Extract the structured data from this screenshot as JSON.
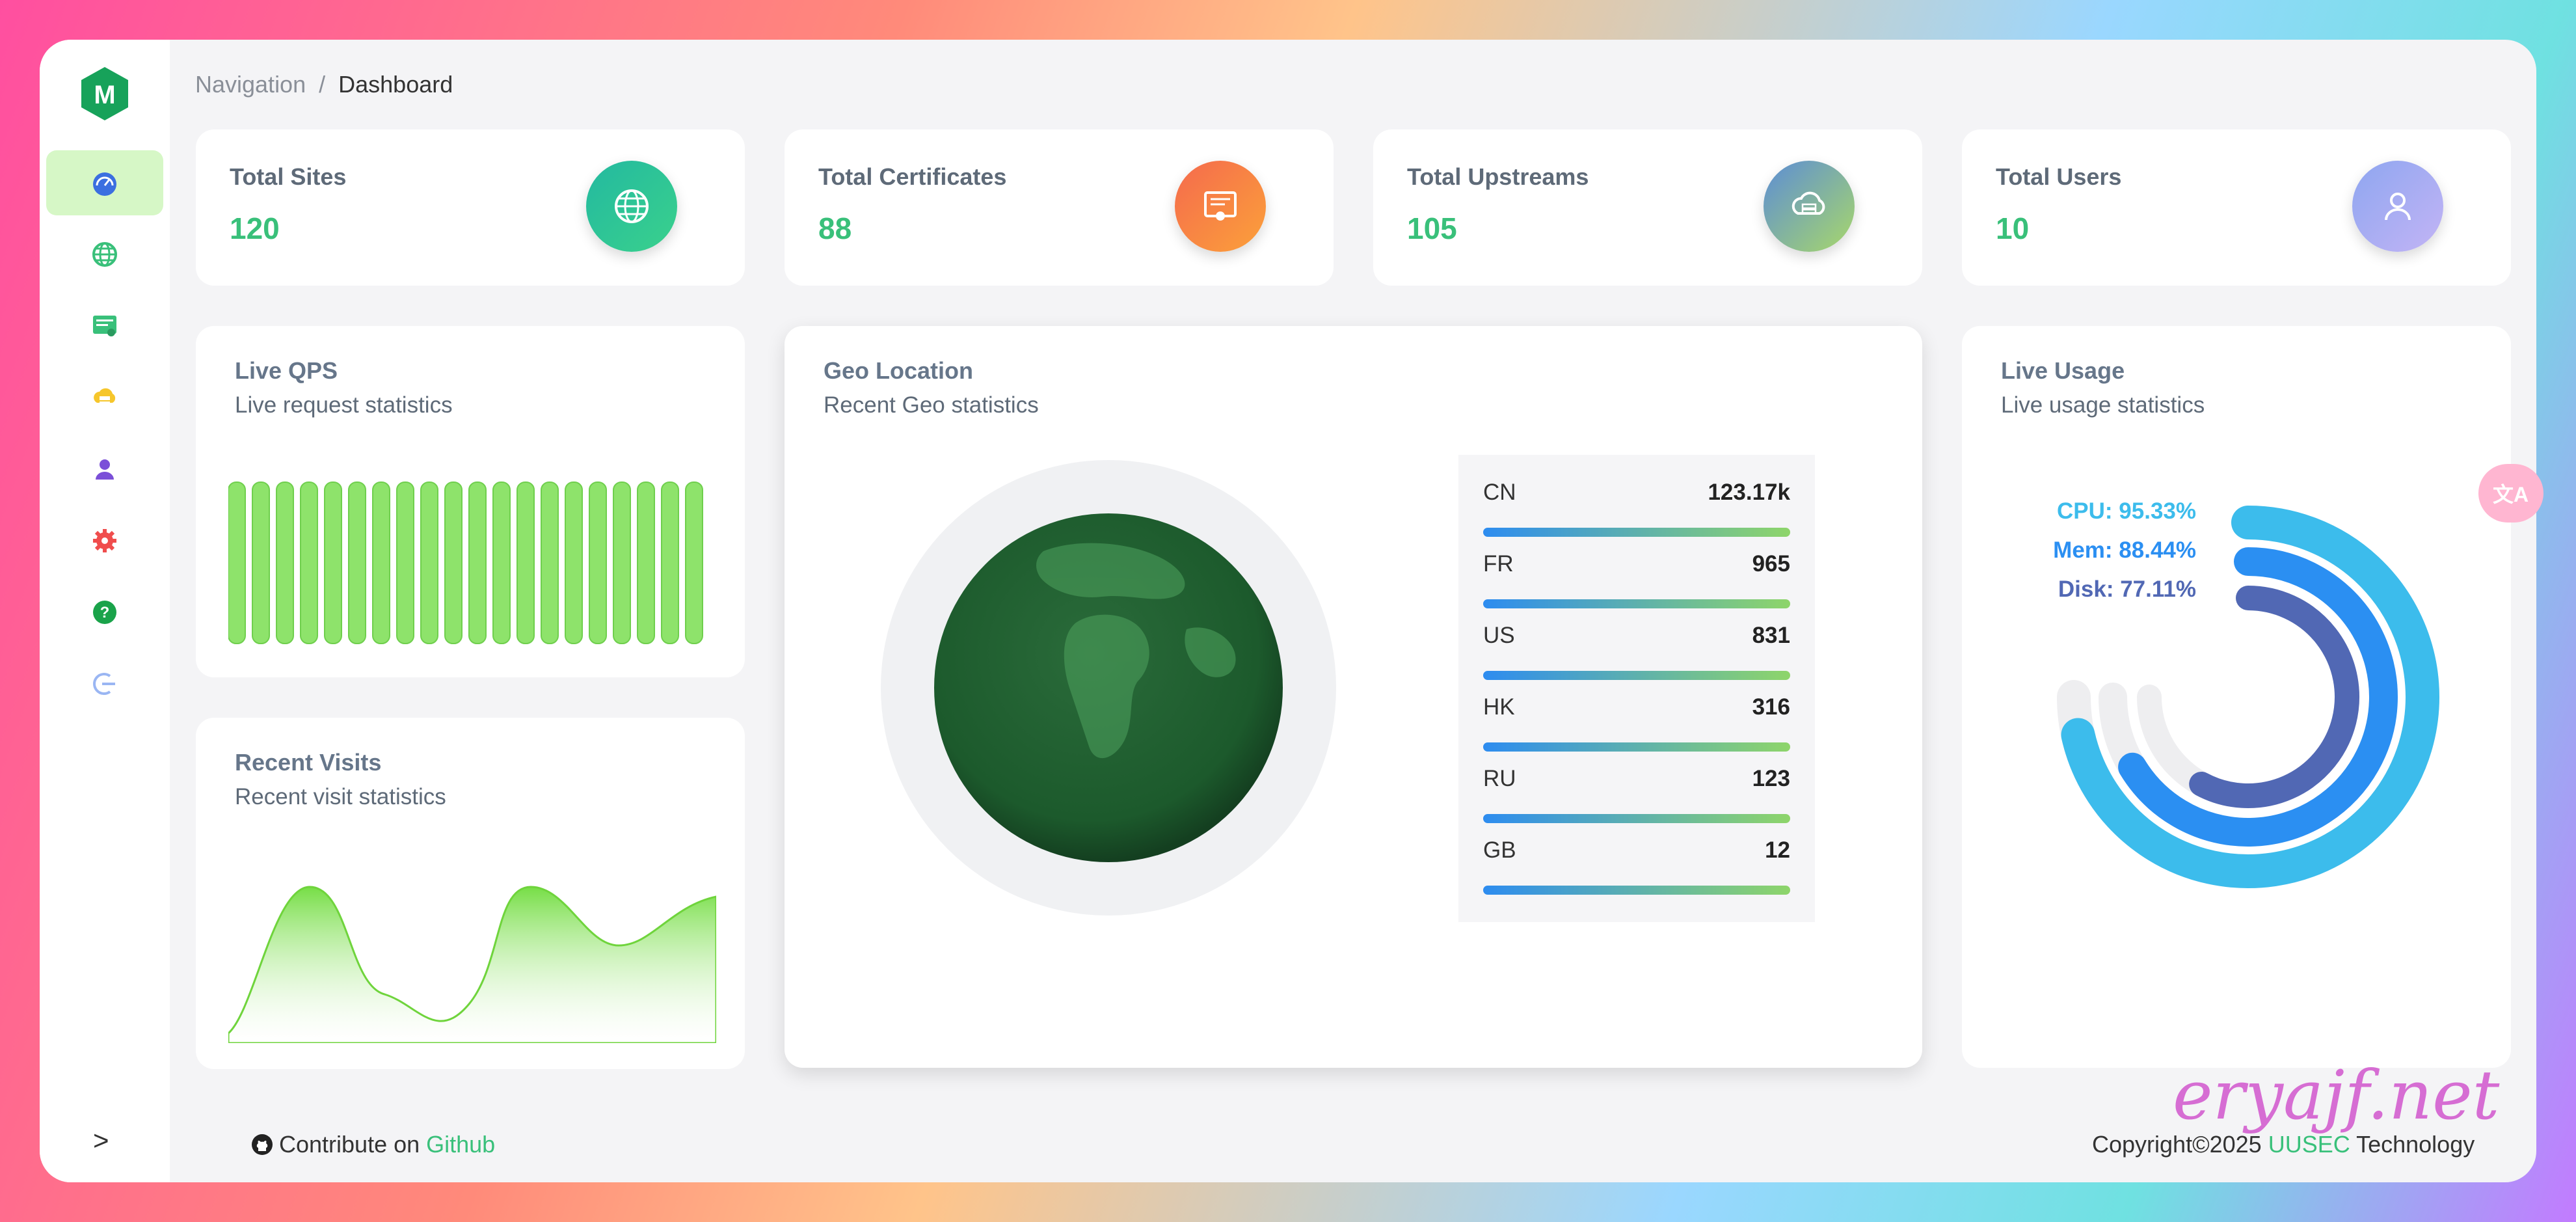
{
  "breadcrumb": {
    "root": "Navigation",
    "separator": "/",
    "current": "Dashboard"
  },
  "logo": {
    "letter": "M"
  },
  "sidebar": {
    "items": [
      {
        "icon": "dashboard-icon",
        "color": "#3b6fe0",
        "active": true
      },
      {
        "icon": "globe-icon",
        "color": "#39c07a"
      },
      {
        "icon": "certificate-icon",
        "color": "#39c07a"
      },
      {
        "icon": "cloud-server-icon",
        "color": "#f6c62b"
      },
      {
        "icon": "user-icon",
        "color": "#7b4fd8"
      },
      {
        "icon": "gear-icon",
        "color": "#f04d4d"
      },
      {
        "icon": "help-icon",
        "color": "#1aa34a"
      },
      {
        "icon": "logout-icon",
        "color": "#9ab6f3"
      }
    ],
    "collapse": ">"
  },
  "stats": [
    {
      "title": "Total Sites",
      "value": "120",
      "icon": "globe-icon",
      "gradient": [
        "#23b9a0",
        "#3ad18c"
      ]
    },
    {
      "title": "Total Certificates",
      "value": "88",
      "icon": "certificate-icon",
      "gradient": [
        "#f56a4d",
        "#fba13a"
      ]
    },
    {
      "title": "Total Upstreams",
      "value": "105",
      "icon": "cloud-server-icon",
      "gradient": [
        "#5c8dd6",
        "#a8d86a"
      ]
    },
    {
      "title": "Total Users",
      "value": "10",
      "icon": "user-icon",
      "gradient": [
        "#8ea6f0",
        "#c3b4f5"
      ]
    }
  ],
  "live_qps": {
    "title": "Live QPS",
    "subtitle": "Live request statistics",
    "bar_count": 20,
    "bar_color": "#8ee36b"
  },
  "recent_visits": {
    "title": "Recent Visits",
    "subtitle": "Recent visit statistics",
    "area_color": "#7fe04f"
  },
  "geo": {
    "title": "Geo Location",
    "subtitle": "Recent Geo statistics",
    "countries": [
      {
        "code": "CN",
        "count": "123.17k"
      },
      {
        "code": "FR",
        "count": "965"
      },
      {
        "code": "US",
        "count": "831"
      },
      {
        "code": "HK",
        "count": "316"
      },
      {
        "code": "RU",
        "count": "123"
      },
      {
        "code": "GB",
        "count": "12"
      }
    ]
  },
  "usage": {
    "title": "Live Usage",
    "subtitle": "Live usage statistics",
    "cpu": {
      "label": "CPU: 95.33%",
      "value": 95.33,
      "color": "#3cbcec"
    },
    "mem": {
      "label": "Mem: 88.44%",
      "value": 88.44,
      "color": "#2b8ff2"
    },
    "disk": {
      "label": "Disk: 77.11%",
      "value": 77.11,
      "color": "#5168b4"
    }
  },
  "footer": {
    "contribute_prefix": "Contribute on",
    "github_link": "Github",
    "copyright_prefix": "Copyright©2025",
    "company_link": "UUSEC",
    "company_suffix": "Technology"
  },
  "translate_button": {
    "label": "文A"
  },
  "watermark": "eryajf.net"
}
